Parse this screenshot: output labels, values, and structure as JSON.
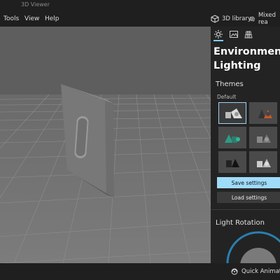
{
  "app": {
    "title": "3D Viewer"
  },
  "menu": {
    "tools": "Tools",
    "view": "View",
    "help": "Help"
  },
  "toolbar": {
    "library_label": "3D library",
    "mixed_reality_label": "Mixed rea"
  },
  "panel": {
    "title": "Environment &\nLighting",
    "themes_label": "Themes",
    "default_label": "Default",
    "save_label": "Save settings",
    "load_label": "Load settings",
    "rotation_label": "Light Rotation"
  },
  "status": {
    "quick_animations_label": "Quick Animations"
  },
  "colors": {
    "accent": "#7ad0f5",
    "primary_button": "#9fdcfa",
    "viewport_bg": "#5e5e5e",
    "panel_bg": "#232323"
  }
}
